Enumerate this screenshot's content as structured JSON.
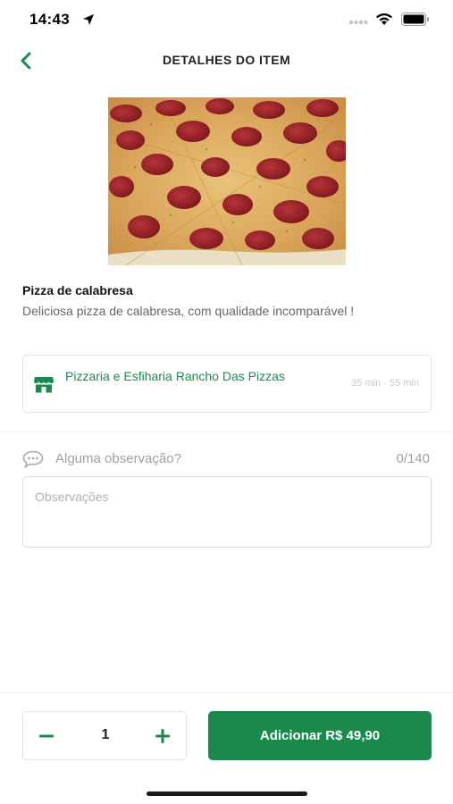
{
  "status_bar": {
    "time": "14:43"
  },
  "header": {
    "title": "DETALHES DO ITEM",
    "back_icon": "chevron-left-icon"
  },
  "item": {
    "image": "pizza-calabresa-photo",
    "name": "Pizza de calabresa",
    "description": "Deliciosa pizza de calabresa, com qualidade incomparável !"
  },
  "store": {
    "icon": "store-icon",
    "name": "Pizzaria e Esfiharia Rancho Das Pizzas",
    "delivery_time": "35 min - 55 min"
  },
  "observations": {
    "icon": "chat-bubble-icon",
    "label": "Alguma observação?",
    "count": "0/140",
    "placeholder": "Observações",
    "value": ""
  },
  "order": {
    "quantity": "1",
    "add_label": "Adicionar R$ 49,90"
  },
  "colors": {
    "accent": "#1a8a4c",
    "store_text": "#1b8a4d"
  }
}
